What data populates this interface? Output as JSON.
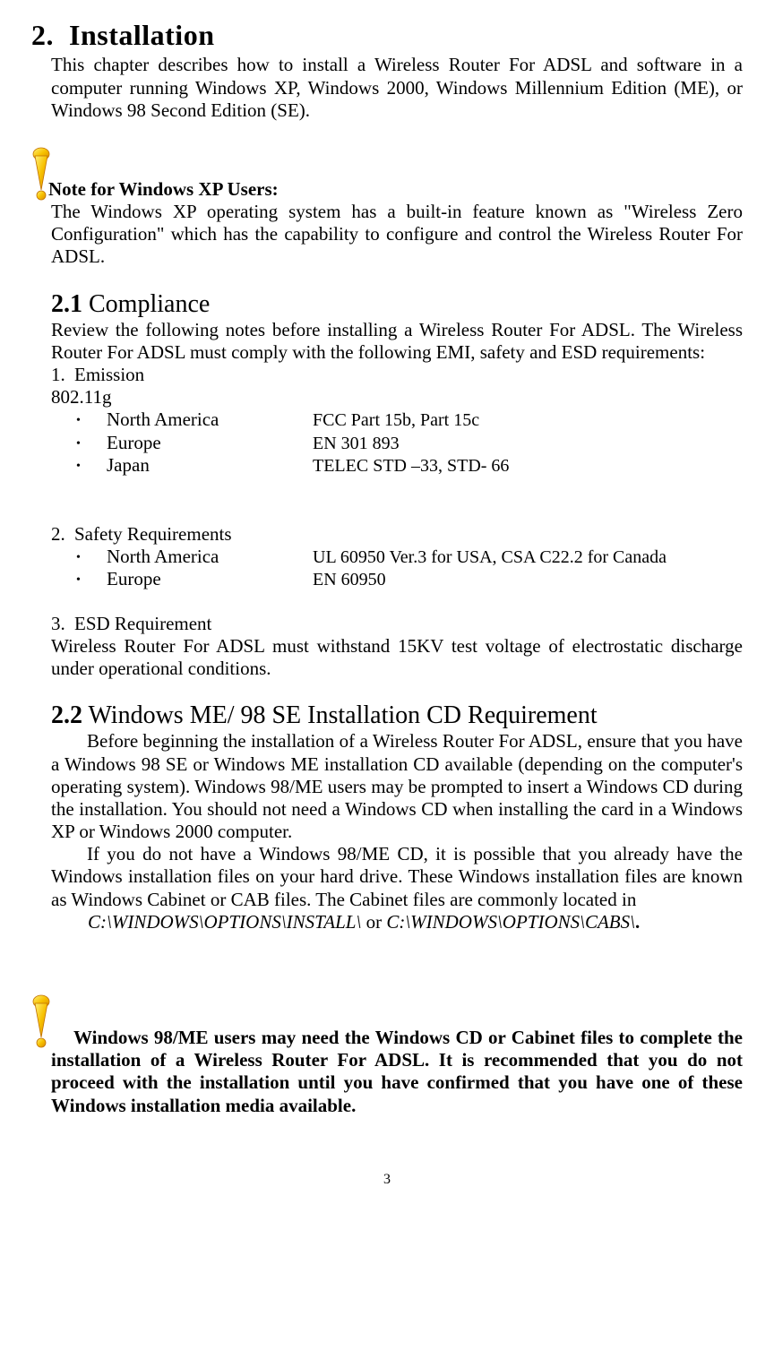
{
  "chapter": {
    "number": "2.",
    "title": "Installation",
    "intro": "This chapter describes how to install a Wireless Router For ADSL and software in a computer running Windows XP, Windows 2000, Windows Millennium Edition (ME), or Windows 98 Second Edition (SE)."
  },
  "note1": {
    "heading": "Note for Windows XP Users:",
    "text": "The Windows XP operating system has a built-in feature known as \"Wireless Zero Configuration\" which has the capability to configure and control the Wireless Router For ADSL."
  },
  "section21": {
    "number": "2.1",
    "title": " Compliance",
    "intro": "Review the following notes before installing a Wireless Router For ADSL. The Wireless Router For ADSL must comply with the following EMI, safety and ESD requirements:",
    "item1": {
      "num": "1.",
      "label": "Emission"
    },
    "standard": "802.11g",
    "emission": {
      "na_label": "North America",
      "na_value": "FCC Part 15b, Part 15c",
      "eu_label": "Europe",
      "eu_value": "EN 301 893",
      "jp_label": "Japan",
      "jp_value": "TELEC STD –33, STD- 66"
    },
    "item2": {
      "num": "2.",
      "label": "Safety Requirements"
    },
    "safety": {
      "na_label": "North America",
      "na_value": "UL 60950 Ver.3 for USA, CSA C22.2 for Canada",
      "eu_label": "Europe",
      "eu_value": "EN 60950"
    },
    "item3": {
      "num": "3.",
      "label": "ESD Requirement"
    },
    "esd_text": "Wireless Router For ADSL must withstand 15KV test voltage of electrostatic discharge under operational conditions."
  },
  "section22": {
    "number": "2.2",
    "title": " Windows ME/ 98 SE Installation CD Requirement",
    "para1": "Before beginning the installation of a Wireless Router For ADSL, ensure that you have a Windows 98 SE or Windows ME installation CD available (depending on the computer's operating system). Windows 98/ME users may be prompted to insert a Windows CD during the installation. You should not need a Windows CD when installing the card in a Windows XP or Windows 2000 computer.",
    "para2": "If you do not have a Windows 98/ME CD, it is possible that you already have the Windows installation files on your hard drive. These Windows installation files are known as Windows Cabinet or CAB files. The Cabinet files are commonly located in",
    "path1": "C:\\WINDOWS\\OPTIONS\\INSTALL\\",
    "or": " or ",
    "path2": "C:\\WINDOWS\\OPTIONS\\CABS\\",
    "dot": "."
  },
  "note2": {
    "text": "Windows 98/ME users may need the Windows CD or Cabinet files to complete the installation of a Wireless Router For ADSL. It is recommended that you do not proceed with the installation until you have confirmed that you have one of these Windows installation media available."
  },
  "page": "3"
}
